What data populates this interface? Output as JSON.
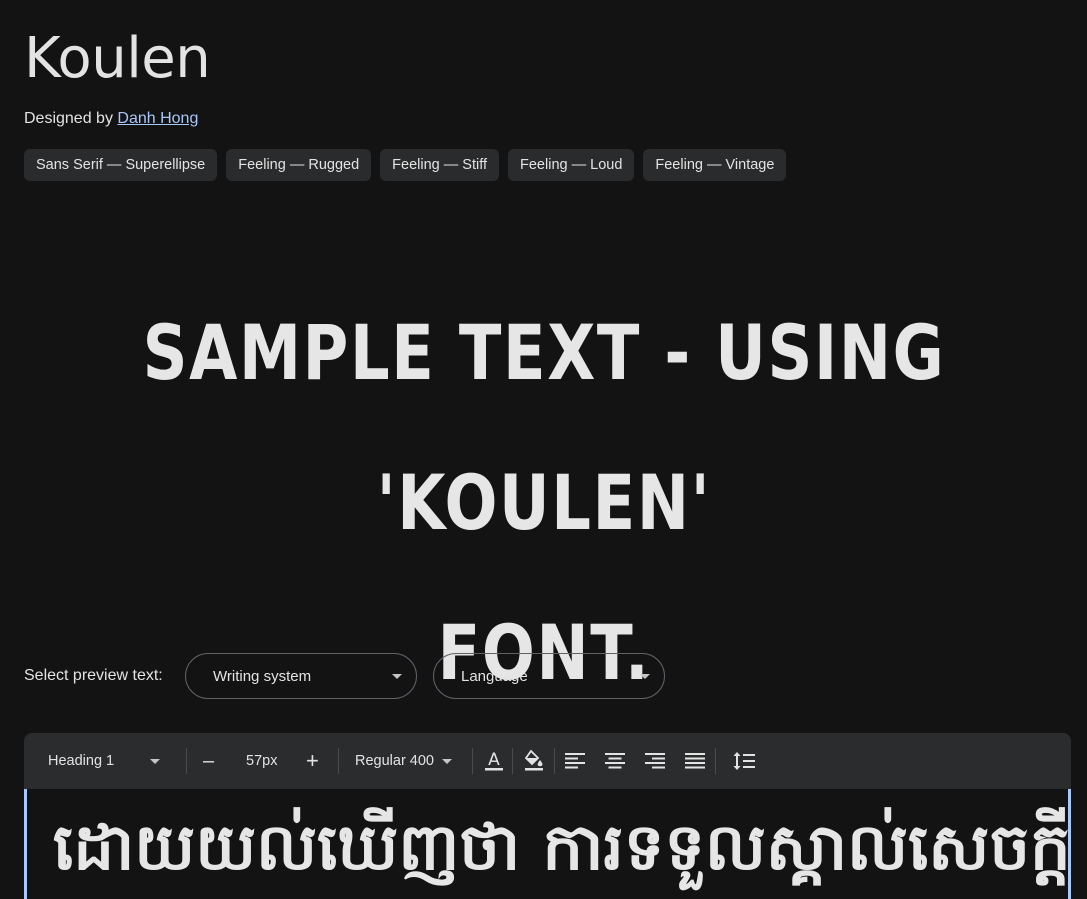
{
  "font": {
    "title": "Koulen",
    "designed_by_label": "Designed by",
    "designer_name": "Danh Hong"
  },
  "tags": [
    "Sans Serif — Superellipse",
    "Feeling — Rugged",
    "Feeling — Stiff",
    "Feeling — Loud",
    "Feeling — Vintage"
  ],
  "sample": {
    "line1": "SAMPLE TEXT - USING 'KOULEN'",
    "line2": "FONT."
  },
  "preview": {
    "label": "Select preview text:",
    "writing_system": "Writing system",
    "language": "Language"
  },
  "toolbar": {
    "style": "Heading 1",
    "minus": "–",
    "size": "57px",
    "plus": "+",
    "weight": "Regular 400",
    "icons": [
      "text-color-icon",
      "highlight-color-icon",
      "align-left-icon",
      "align-center-icon",
      "align-right-icon",
      "align-justify-icon",
      "line-height-icon"
    ]
  },
  "editor": {
    "text": "ដោយយល់ឃើញថា ការទទួលស្គាល់សេចក្តី"
  },
  "colors": {
    "background": "#131313",
    "chip": "#2a2b2c",
    "link": "#a8c7fa",
    "toolbar": "#2b2c2e"
  }
}
